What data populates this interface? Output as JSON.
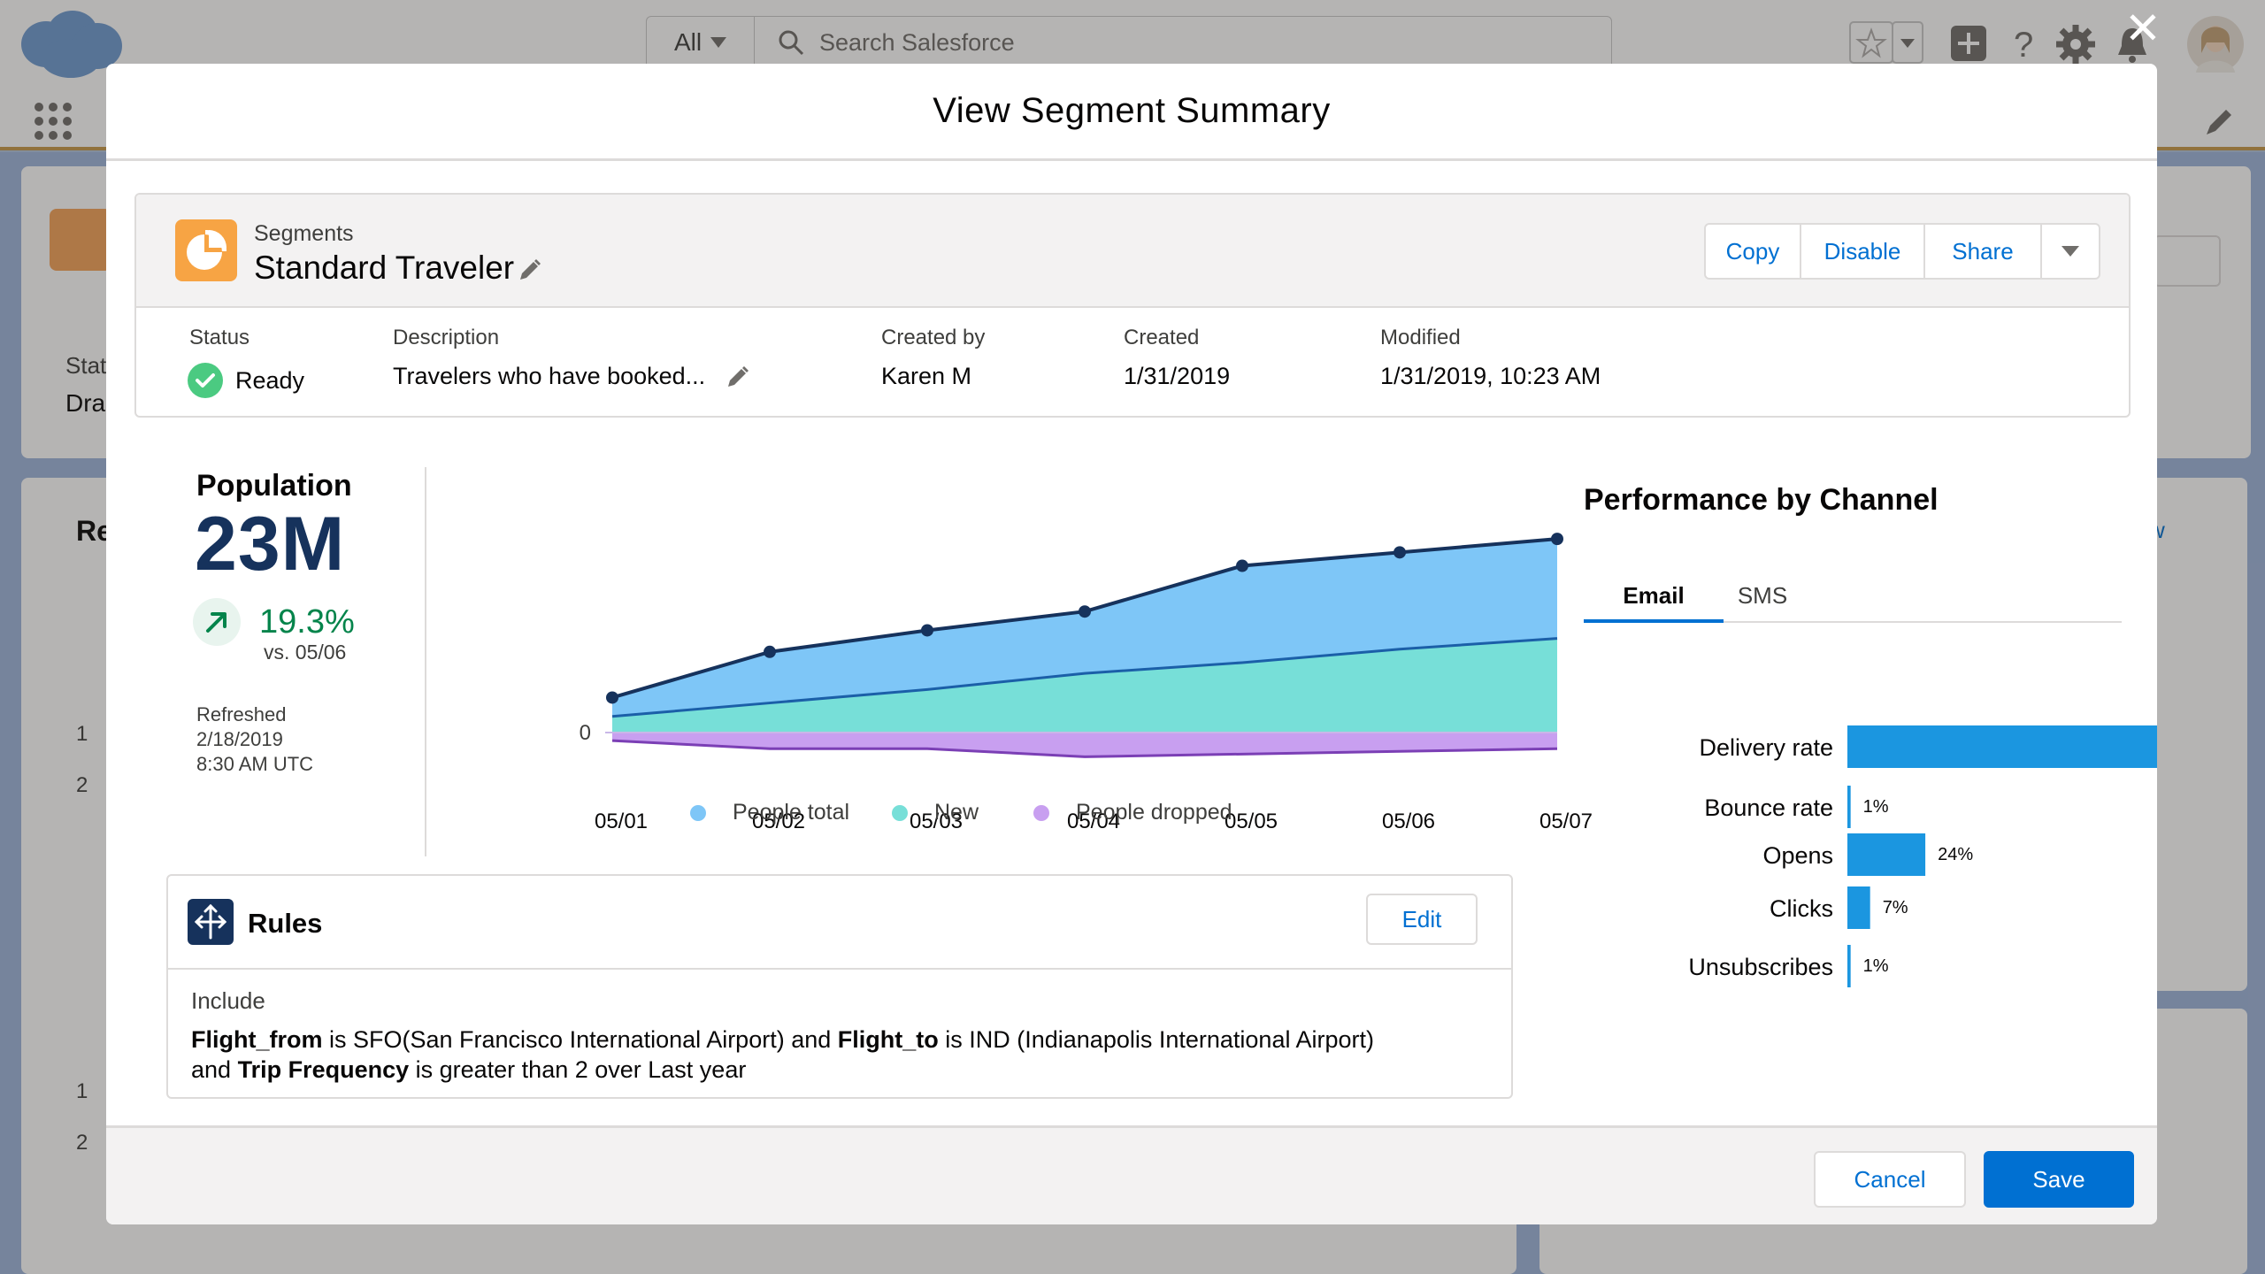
{
  "app": {
    "search": {
      "scope": "All",
      "placeholder": "Search Salesforce"
    },
    "bg_labels": {
      "stat": "Stat",
      "dra": "Dra",
      "re": "Re",
      "w": "w",
      "n1": "1",
      "n2": "2",
      "n3": "1",
      "n4": "2"
    }
  },
  "modal": {
    "title": "View Segment Summary",
    "close": "✕",
    "record": {
      "object": "Segments",
      "name": "Standard Traveler",
      "actions": [
        "Copy",
        "Disable",
        "Share"
      ],
      "fields": {
        "status_label": "Status",
        "status_value": "Ready",
        "description_label": "Description",
        "description_value": "Travelers who have booked...",
        "created_by_label": "Created by",
        "created_by_value": "Karen M",
        "created_label": "Created",
        "created_value": "1/31/2019",
        "modified_label": "Modified",
        "modified_value": "1/31/2019, 10:23 AM"
      }
    },
    "population": {
      "label": "Population",
      "value": "23M",
      "change": "19.3%",
      "vs": "vs. 05/06",
      "refreshed_label": "Refreshed",
      "refreshed_date": "2/18/2019",
      "refreshed_time": "8:30 AM UTC"
    },
    "performance": {
      "title": "Performance by Channel",
      "tabs": [
        "Email",
        "SMS"
      ],
      "active_tab": "Email"
    },
    "rules": {
      "title": "Rules",
      "edit": "Edit",
      "include": "Include",
      "line1": {
        "f1": "Flight_from",
        "t1": " is SFO(San Francisco International Airport) and ",
        "f2": "Flight_to",
        "t2": " is IND (Indianapolis International Airport)"
      },
      "line2": {
        "t0": "and ",
        "f3": "Trip Frequency",
        "t3": " is greater than 2 over Last year"
      }
    },
    "footer": {
      "cancel": "Cancel",
      "save": "Save"
    }
  },
  "colors": {
    "brand": "#0070d2",
    "people_total": "#7ec6f7",
    "new": "#77dfd8",
    "people_dropped": "#c89ff0",
    "line_dark": "#16325c",
    "bar": "#1b96e0",
    "segment_icon": "#f7a444",
    "success": "#04844b"
  },
  "chart_data": [
    {
      "type": "area",
      "categories": [
        "05/01",
        "05/02",
        "05/03",
        "05/04",
        "05/05",
        "05/06",
        "05/07"
      ],
      "y_zero_label": "0",
      "series": [
        {
          "name": "People total",
          "values": [
            13,
            30,
            38,
            45,
            62,
            67,
            72
          ]
        },
        {
          "name": "New",
          "values": [
            6,
            11,
            16,
            22,
            26,
            31,
            35
          ]
        },
        {
          "name": "People dropped",
          "values": [
            -3,
            -6,
            -6,
            -9,
            -8,
            -7,
            -6
          ]
        }
      ],
      "ylim": [
        -10,
        75
      ],
      "legend": "bottom"
    },
    {
      "type": "bar",
      "orientation": "horizontal",
      "categories": [
        "Delivery rate",
        "Bounce rate",
        "Opens",
        "Clicks",
        "Unsubscribes"
      ],
      "values": [
        97,
        1,
        24,
        7,
        1
      ],
      "value_labels": [
        "97%",
        "1%",
        "24%",
        "7%",
        "1%"
      ],
      "xlim": [
        0,
        100
      ]
    }
  ]
}
